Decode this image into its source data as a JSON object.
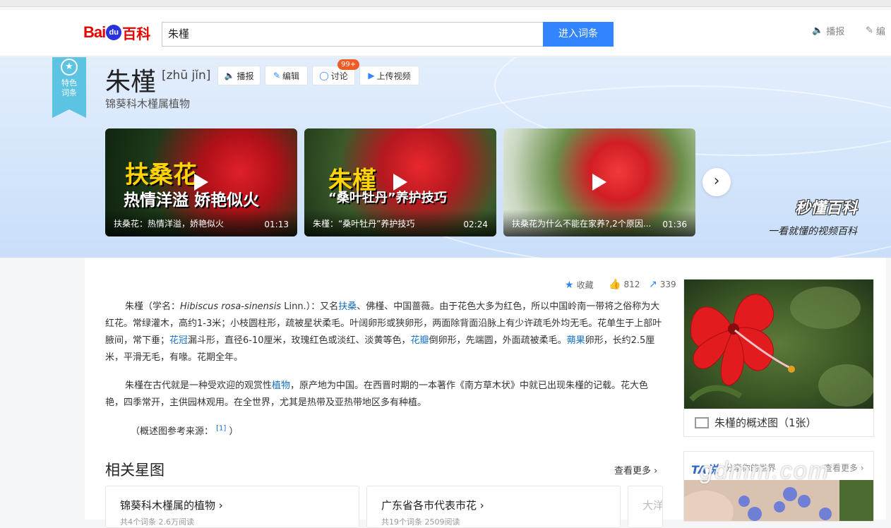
{
  "header": {
    "logo": {
      "bai": "Bai",
      "du": "du",
      "ke": "百科"
    },
    "search_value": "朱槿",
    "search_button": "进入词条",
    "broadcast": "播报",
    "edit": "编"
  },
  "entry": {
    "ribbon": "特色词条",
    "title": "朱槿",
    "pinyin": "[zhū jǐn]",
    "subtitle": "锦葵科木槿属植物",
    "toolbar": {
      "broadcast": "播报",
      "edit": "编辑",
      "discuss": "讨论",
      "discuss_badge": "99+",
      "upload_video": "上传视频"
    }
  },
  "videos": [
    {
      "overlay1": "扶桑花",
      "overlay2": "热情洋溢 娇艳似火",
      "title": "扶桑花：热情洋溢，娇艳似火",
      "duration": "01:13"
    },
    {
      "overlay1": "朱槿",
      "overlay2": "“桑叶牡丹”养护技巧",
      "title": "朱槿：“桑叶牡丹”养护技巧",
      "duration": "02:24"
    },
    {
      "overlay1": "",
      "overlay2": "",
      "title": "扶桑花为什么不能在家养?,2个原因...",
      "duration": "01:36"
    }
  ],
  "brand": {
    "name": "秒懂百科",
    "tagline": "一看就懂的视频百科"
  },
  "actions": {
    "favorite": "收藏",
    "likes": "812",
    "shares": "339"
  },
  "body": {
    "p1": {
      "t1": "朱槿（学名：",
      "latin": "Hibiscus rosa-sinensis",
      "t2": " Linn.）：又名",
      "l1": "扶桑",
      "t3": "、佛槿、中国蔷薇。由于花色大多为红色，所以中国岭南一带将之俗称为大红花。常绿灌木，高约1-3米；小枝圆柱形，疏被星状柔毛。叶阔卵形或狭卵形，两面除背面沿脉上有少许疏毛外均无毛。花单生于上部叶腋间，常下垂；",
      "l2": "花冠",
      "t4": "漏斗形，直径6-10厘米，玫瑰红色或淡红、淡黄等色，",
      "l3": "花瓣",
      "t5": "倒卵形，先端圆，外面疏被柔毛。",
      "l4": "蒴果",
      "t6": "卵形，长约2.5厘米，平滑无毛，有喙。花期全年。"
    },
    "p2": {
      "t1": "朱槿在古代就是一种受欢迎的观赏性",
      "l1": "植物",
      "t2": "，原产地为中国。在西晋时期的一本著作《南方草木状》中就已出现朱槿的记载。花大色艳，四季常开，主供园林观用。在全世界，尤其是热带及亚热带地区多有种植。"
    },
    "ref_prefix": "（概述图参考来源：",
    "ref_num": "[1]",
    "ref_suffix": "）"
  },
  "related": {
    "title": "相关星图",
    "see_more": "查看更多",
    "cards": [
      {
        "title": "锦葵科木槿属的植物",
        "stats": "共4个词条  2.6万阅读"
      },
      {
        "title": "广东省各市代表市花",
        "stats": "共19个词条  2509阅读"
      },
      {
        "title": "大洋",
        "stats": ""
      }
    ]
  },
  "sidebar": {
    "image_caption": "朱槿的概述图（1张）",
    "ta_logo": "TA说",
    "ta_sub": "分享你的世界",
    "ta_more": "查看更多",
    "watermark": "gdmm.com"
  }
}
